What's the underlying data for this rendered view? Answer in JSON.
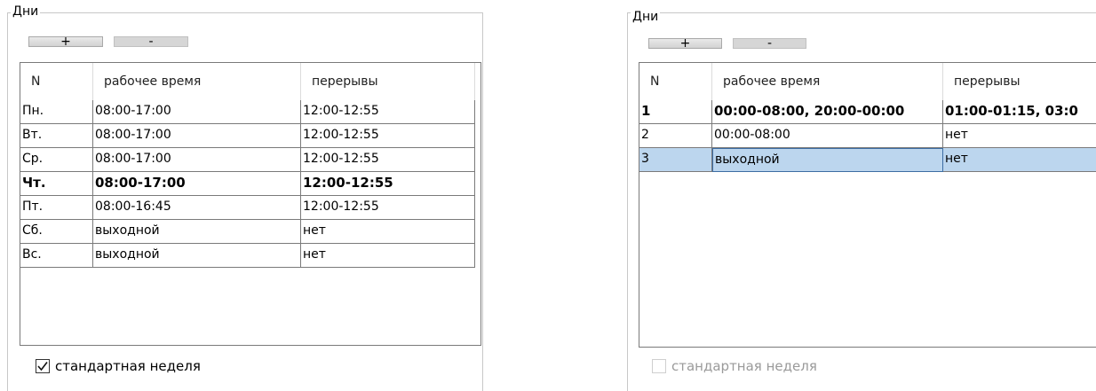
{
  "left": {
    "group_title": "Дни",
    "add_label": "+",
    "remove_label": "-",
    "columns": [
      "N",
      "рабочее время",
      "перерывы"
    ],
    "rows": [
      {
        "n": "Пн.",
        "work": "08:00-17:00",
        "breaks": "12:00-12:55",
        "bold": false
      },
      {
        "n": "Вт.",
        "work": "08:00-17:00",
        "breaks": "12:00-12:55",
        "bold": false
      },
      {
        "n": "Ср.",
        "work": "08:00-17:00",
        "breaks": "12:00-12:55",
        "bold": false
      },
      {
        "n": "Чт.",
        "work": "08:00-17:00",
        "breaks": "12:00-12:55",
        "bold": true
      },
      {
        "n": "Пт.",
        "work": "08:00-16:45",
        "breaks": "12:00-12:55",
        "bold": false
      },
      {
        "n": "Сб.",
        "work": "выходной",
        "breaks": "нет",
        "bold": false
      },
      {
        "n": "Вс.",
        "work": "выходной",
        "breaks": "нет",
        "bold": false
      }
    ],
    "checkbox_label": "стандартная неделя",
    "checkbox_checked": true,
    "checkmark_glyph": "✓"
  },
  "right": {
    "group_title": "Дни",
    "add_label": "+",
    "remove_label": "-",
    "columns": [
      "N",
      "рабочее время",
      "перерывы"
    ],
    "rows": [
      {
        "n": "1",
        "work": "00:00-08:00, 20:00-00:00",
        "breaks": "01:00-01:15, 03:0",
        "bold": true,
        "selected": false
      },
      {
        "n": "2",
        "work": "00:00-08:00",
        "breaks": "нет",
        "bold": false,
        "selected": false
      },
      {
        "n": "3",
        "work": "выходной",
        "breaks": "нет",
        "bold": false,
        "selected": true
      }
    ],
    "checkbox_label": "стандартная неделя",
    "checkbox_checked": false,
    "selection_color": "#bcd6ee"
  }
}
